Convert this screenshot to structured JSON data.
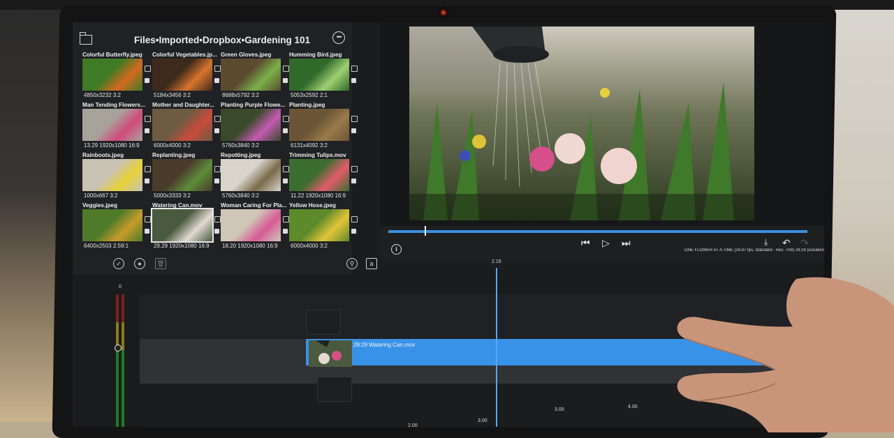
{
  "browser": {
    "path": "Files•Imported•Dropbox•Gardening 101",
    "clips": [
      {
        "name": "Colorful Butterfly.jpeg",
        "meta": "4850x3232 3:2",
        "col": 0,
        "row": 0,
        "c1": "#3f7a24",
        "c2": "#d46a1f"
      },
      {
        "name": "Colorful Vegetables.jp...",
        "meta": "5184x3456 3:2",
        "col": 1,
        "row": 0,
        "c1": "#3e2a1b",
        "c2": "#d9742e"
      },
      {
        "name": "Green Gloves.jpeg",
        "meta": "8688x5792 3:2",
        "col": 2,
        "row": 0,
        "c1": "#5a4a2e",
        "c2": "#7bb04a"
      },
      {
        "name": "Humming Bird.jpeg",
        "meta": "5053x2592 2:1",
        "col": 3,
        "row": 0,
        "c1": "#2f6a2a",
        "c2": "#9fcf72"
      },
      {
        "name": "Man Tending Flowers...",
        "meta": "13.29 1920x1080 16:9",
        "col": 0,
        "row": 1,
        "c1": "#a8a39a",
        "c2": "#d04a7a"
      },
      {
        "name": "Mother and Daughter...",
        "meta": "6000x4000 3:2",
        "col": 1,
        "row": 1,
        "c1": "#6d5b43",
        "c2": "#c84b3c"
      },
      {
        "name": "Planting Purple Flowe...",
        "meta": "5760x3840 3:2",
        "col": 2,
        "row": 1,
        "c1": "#3a4a2a",
        "c2": "#c35ab3"
      },
      {
        "name": "Planting.jpeg",
        "meta": "6131x4092 3:2",
        "col": 3,
        "row": 1,
        "c1": "#6a5536",
        "c2": "#9a7a4a"
      },
      {
        "name": "Rainboots.jpeg",
        "meta": "1000x667 3:2",
        "col": 0,
        "row": 2,
        "c1": "#c8c2b3",
        "c2": "#e8d23a"
      },
      {
        "name": "Replanting.jpeg",
        "meta": "5000x3333 3:2",
        "col": 1,
        "row": 2,
        "c1": "#4a3b2b",
        "c2": "#5e8d3a"
      },
      {
        "name": "Repotting.jpeg",
        "meta": "5760x3840 3:2",
        "col": 2,
        "row": 2,
        "c1": "#d8d4cc",
        "c2": "#7a6a4a"
      },
      {
        "name": "Trimming Tulips.mov",
        "meta": "11.22 1920x1080 16:9",
        "col": 3,
        "row": 2,
        "c1": "#3c6e2f",
        "c2": "#e35a6a"
      },
      {
        "name": "Veggies.jpeg",
        "meta": "6400x2503 2.59:1",
        "col": 0,
        "row": 3,
        "c1": "#4f7a2a",
        "c2": "#c79b2a"
      },
      {
        "name": "Watering Can.mov",
        "meta": "29.29 1920x1080 16:9",
        "col": 1,
        "row": 3,
        "c1": "#4a5a3e",
        "c2": "#e2d9d2",
        "selected": true
      },
      {
        "name": "Woman Caring For Pla...",
        "meta": "18.20 1920x1080 16:9",
        "col": 2,
        "row": 3,
        "c1": "#cfc6b7",
        "c2": "#d85a95"
      },
      {
        "name": "Yellow Hose.jpeg",
        "meta": "6000x4000 3:2",
        "col": 3,
        "row": 3,
        "c1": "#5d8a2a",
        "c2": "#e3c43a"
      }
    ]
  },
  "viewer": {
    "sequence_info": "ONE FLOWER AT A TIME (29.97 fps, Standard - Rec. 709) 29:29 (Duration"
  },
  "timeline": {
    "playhead_time": "2.15",
    "meter_zero": "0",
    "clip_label": "29:29 Watering Can.mov",
    "ruler_labels": [
      "3.00",
      "4.00",
      "3.00",
      "2.00"
    ]
  },
  "colors": {
    "accent": "#3893e8",
    "panel": "#202124",
    "timeline_bg": "#1a1b1d"
  }
}
